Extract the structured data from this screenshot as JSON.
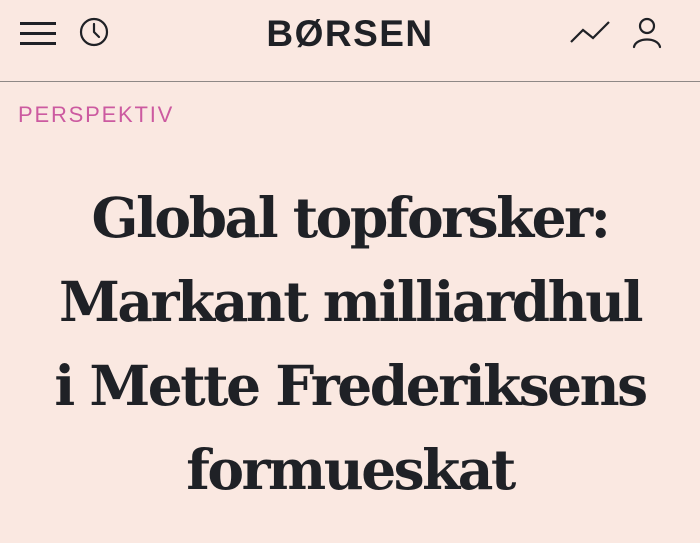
{
  "header": {
    "logo": "BØRSEN",
    "icons": {
      "menu": "hamburger-menu-icon",
      "history": "clock-icon",
      "markets": "trend-line-icon",
      "account": "user-icon"
    }
  },
  "article": {
    "kicker": "PERSPEKTIV",
    "headline_lines": [
      "Global topforsker:",
      "Markant milliardhul",
      "i Mette Frederiksens",
      "formueskat"
    ]
  },
  "colors": {
    "background": "#fae8e1",
    "text": "#1f2126",
    "kicker": "#cc5aa0",
    "divider": "#8e8886"
  }
}
